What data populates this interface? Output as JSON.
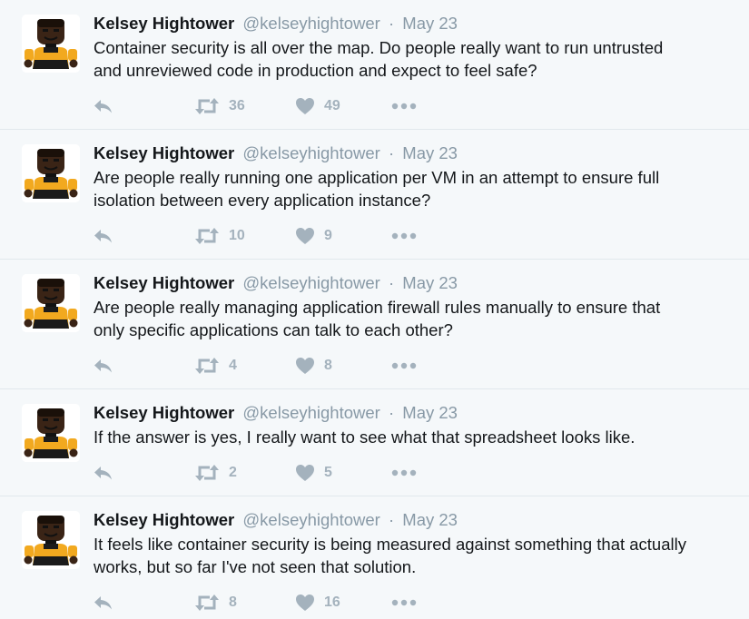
{
  "tweets": [
    {
      "fullname": "Kelsey Hightower",
      "username": "@kelseyhightower",
      "time": "May 23",
      "text_lines": [
        "Container security is all over the map. Do people really want to run untrusted",
        "and unreviewed code in production and expect to feel safe?"
      ],
      "retweets": "36",
      "likes": "49"
    },
    {
      "fullname": "Kelsey Hightower",
      "username": "@kelseyhightower",
      "time": "May 23",
      "text_lines": [
        "Are people really running one application per VM in an attempt to ensure full",
        "isolation between every application instance?"
      ],
      "retweets": "10",
      "likes": "9"
    },
    {
      "fullname": "Kelsey Hightower",
      "username": "@kelseyhightower",
      "time": "May 23",
      "text_lines": [
        "Are people really managing application firewall rules manually to ensure that",
        "only specific applications can talk to each other?"
      ],
      "retweets": "4",
      "likes": "8"
    },
    {
      "fullname": "Kelsey Hightower",
      "username": "@kelseyhightower",
      "time": "May 23",
      "text_lines": [
        "If the answer is yes, I really want to see what that spreadsheet looks like."
      ],
      "retweets": "2",
      "likes": "5"
    },
    {
      "fullname": "Kelsey Hightower",
      "username": "@kelseyhightower",
      "time": "May 23",
      "text_lines": [
        "It feels like container security is being measured against something that actually",
        "works, but so far I've not seen that solution."
      ],
      "retweets": "8",
      "likes": "16"
    }
  ],
  "icons": {
    "reply": "reply-icon",
    "retweet": "retweet-icon",
    "like": "heart-icon",
    "more": "more-options-icon"
  },
  "colors": {
    "background": "#f5f8fa",
    "icon_gray": "#a4b2bd",
    "divider": "#e1e8ed"
  }
}
